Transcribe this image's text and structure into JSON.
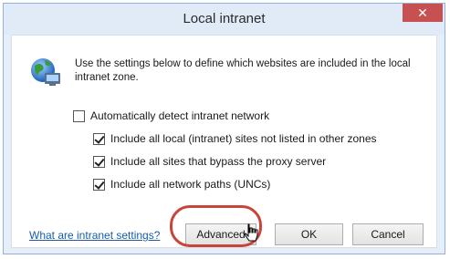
{
  "window": {
    "title": "Local intranet",
    "close_label": "✕"
  },
  "description": "Use the settings below to define which websites are included in the local intranet zone.",
  "checkboxes": [
    {
      "label": "Automatically detect intranet network",
      "checked": false
    },
    {
      "label": "Include all local (intranet) sites not listed in other zones",
      "checked": true
    },
    {
      "label": "Include all sites that bypass the proxy server",
      "checked": true
    },
    {
      "label": "Include all network paths (UNCs)",
      "checked": true
    }
  ],
  "footer": {
    "help_link": "What are intranet settings?",
    "advanced_label": "Advanced",
    "ok_label": "OK",
    "cancel_label": "Cancel"
  },
  "colors": {
    "close": "#c75050",
    "highlight": "#c8453a",
    "link": "#1a5ca8"
  },
  "icons": [
    "globe-icon",
    "close-icon",
    "mouse-pointer-icon"
  ]
}
